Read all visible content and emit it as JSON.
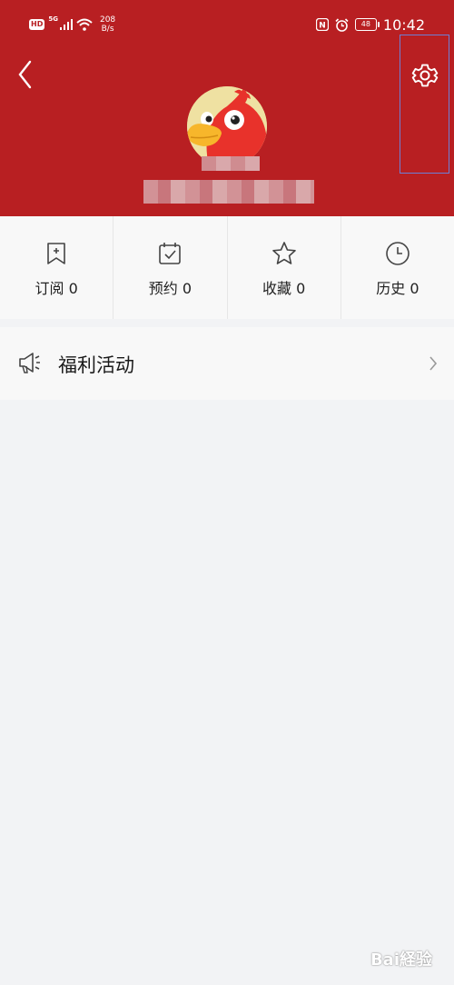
{
  "status_bar": {
    "hd": "HD",
    "network": "5G",
    "speed_value": "208",
    "speed_unit": "B/s",
    "nfc": "N",
    "battery": "48",
    "time": "10:42"
  },
  "tabs": [
    {
      "label": "订阅 0",
      "icon": "bookmark-plus-icon"
    },
    {
      "label": "预约 0",
      "icon": "calendar-check-icon"
    },
    {
      "label": "收藏 0",
      "icon": "star-icon"
    },
    {
      "label": "历史 0",
      "icon": "clock-icon"
    }
  ],
  "welfare": {
    "label": "福利活动",
    "icon": "megaphone-icon"
  },
  "watermark": {
    "text": "Bai経验"
  },
  "colors": {
    "header": "#b81f22",
    "background": "#f2f3f5",
    "panel": "#f8f8f8"
  }
}
